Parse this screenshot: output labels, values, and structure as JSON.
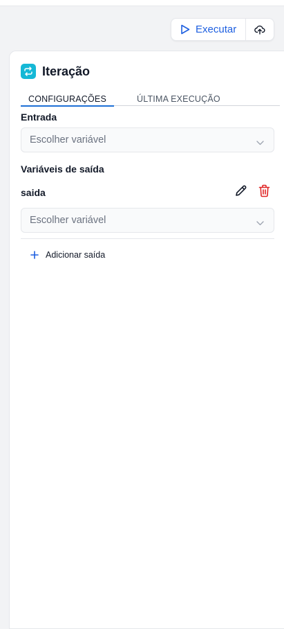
{
  "toolbar": {
    "run_label": "Executar",
    "run_icon": "play-icon",
    "upload_icon": "cloud-upload-icon"
  },
  "node": {
    "icon": "loop-arrows-icon",
    "icon_color": "#15b8d6",
    "title": "Iteração"
  },
  "tabs": [
    {
      "label": "CONFIGURAÇÕES",
      "active": true
    },
    {
      "label": "ÚLTIMA EXECUÇÃO",
      "active": false
    }
  ],
  "input": {
    "label": "Entrada",
    "placeholder": "Escolher variável"
  },
  "outputs": {
    "label": "Variáveis de saída",
    "items": [
      {
        "name": "saida",
        "placeholder": "Escolher variável"
      }
    ],
    "add_label": "Adicionar saída"
  },
  "colors": {
    "accent": "#1d5fe0",
    "danger": "#e02424",
    "tab_underline": "#1d6fd6"
  }
}
